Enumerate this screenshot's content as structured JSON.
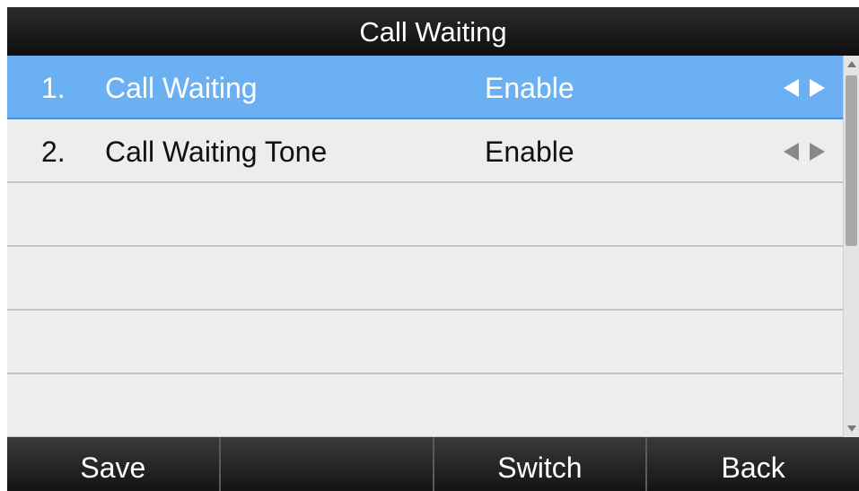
{
  "title": "Call Waiting",
  "rows": [
    {
      "number": "1.",
      "label": "Call Waiting",
      "value": "Enable",
      "selected": true
    },
    {
      "number": "2.",
      "label": "Call Waiting Tone",
      "value": "Enable",
      "selected": false
    }
  ],
  "arrow_icons": {
    "left": "left-arrow-icon",
    "right": "right-arrow-icon"
  },
  "softkeys": [
    "Save",
    "",
    "Switch",
    "Back"
  ],
  "colors": {
    "title_bar": "#1c1c1c",
    "selected_row": "#6ab0f3",
    "row_background": "#ededed",
    "softkey_bar": "#262626"
  }
}
